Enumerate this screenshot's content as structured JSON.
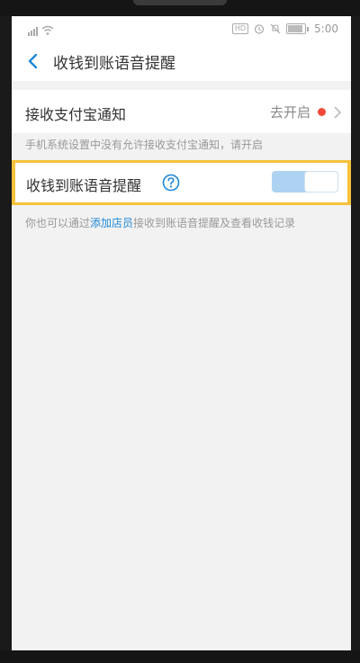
{
  "status_bar": {
    "time": "5:00",
    "hd_badge": "HD",
    "icons": [
      "signal-icon",
      "wifi-icon",
      "hd-icon",
      "alarm-icon",
      "mute-icon",
      "battery-icon"
    ]
  },
  "nav": {
    "title": "收钱到账语音提醒",
    "back_icon": "chevron-left-icon"
  },
  "notify_row": {
    "label": "接收支付宝通知",
    "action_text": "去开启",
    "dot_color": "#f24a3a"
  },
  "notify_hint": "手机系统设置中没有允许接收支付宝通知，请开启",
  "voice_row": {
    "label": "收钱到账语音提醒",
    "help_icon": "question-circle-icon",
    "toggle_on": true
  },
  "footer_hint": {
    "before": "你也可以通过",
    "link": "添加店员",
    "after": "接收到账语音提醒及查看收钱记录"
  },
  "colors": {
    "accent": "#1e88d8",
    "highlight_border": "#f6c23c",
    "toggle_track": "#aed3f2"
  }
}
